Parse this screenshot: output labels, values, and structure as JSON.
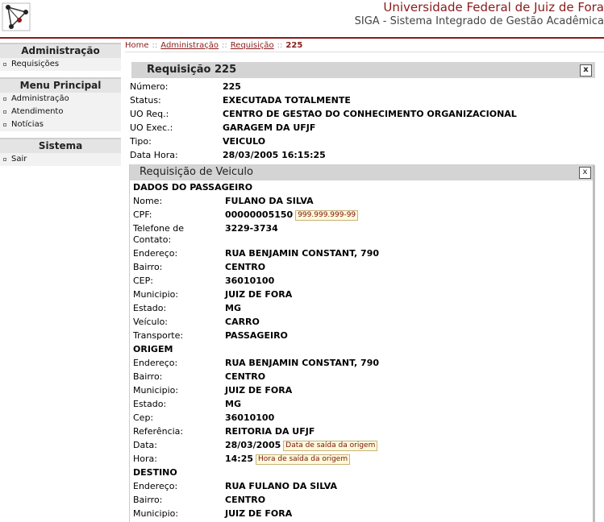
{
  "header": {
    "title": "Universidade Federal de Juiz de Fora",
    "subtitle": "SIGA - Sistema Integrado de Gestão Acadêmica",
    "accent": "#8b1a1a"
  },
  "sidebar": {
    "sections": [
      {
        "title": "Administração",
        "items": [
          {
            "label": "Requisições"
          }
        ]
      },
      {
        "title": "Menu Principal",
        "items": [
          {
            "label": "Administração"
          },
          {
            "label": "Atendimento"
          },
          {
            "label": "Notícias"
          }
        ]
      },
      {
        "title": "Sistema",
        "items": [
          {
            "label": "Sair"
          }
        ]
      }
    ]
  },
  "breadcrumb": {
    "home": "Home",
    "sep": "::",
    "admin": "Administração",
    "req": "Requisição",
    "current": "225"
  },
  "requisicao": {
    "title": "Requisição 225",
    "close": "x",
    "fields": [
      {
        "label": "Número:",
        "value": "225"
      },
      {
        "label": "Status:",
        "value": "EXECUTADA TOTALMENTE"
      },
      {
        "label": "UO Req.:",
        "value": "CENTRO DE GESTAO DO CONHECIMENTO ORGANIZACIONAL"
      },
      {
        "label": "UO Exec.:",
        "value": "GARAGEM DA UFJF"
      },
      {
        "label": "Tipo:",
        "value": "VEICULO"
      },
      {
        "label": "Data Hora:",
        "value": "28/03/2005 16:15:25"
      }
    ]
  },
  "veiculo": {
    "title": "Requisição de Veiculo",
    "close": "x",
    "passageiro": {
      "heading": "DADOS DO PASSAGEIRO",
      "nome_label": "Nome:",
      "nome": "FULANO DA SILVA",
      "cpf_label": "CPF:",
      "cpf": "00000005150",
      "cpf_hint": "999.999.999-99",
      "tel_label": "Telefone de Contato:",
      "tel": "3229-3734",
      "end_label": "Endereço:",
      "end": "RUA BENJAMIN CONSTANT, 790",
      "bairro_label": "Bairro:",
      "bairro": "CENTRO",
      "cep_label": "CEP:",
      "cep": "36010100",
      "mun_label": "Municipio:",
      "mun": "JUIZ DE FORA",
      "estado_label": "Estado:",
      "estado": "MG",
      "veic_label": "Veículo:",
      "veic": "CARRO",
      "transp_label": "Transporte:",
      "transp": "PASSAGEIRO"
    },
    "origem": {
      "heading": "ORIGEM",
      "end_label": "Endereço:",
      "end": "RUA BENJAMIN CONSTANT, 790",
      "bairro_label": "Bairro:",
      "bairro": "CENTRO",
      "mun_label": "Municipio:",
      "mun": "JUIZ DE FORA",
      "estado_label": "Estado:",
      "estado": "MG",
      "cep_label": "Cep:",
      "cep": "36010100",
      "ref_label": "Referência:",
      "ref": "REITORIA DA UFJF",
      "data_label": "Data:",
      "data": "28/03/2005",
      "data_hint": "Data de saída da origem",
      "hora_label": "Hora:",
      "hora": "14:25",
      "hora_hint": "Hora de saída da origem"
    },
    "destino": {
      "heading": "DESTINO",
      "end_label": "Endereço:",
      "end": "RUA FULANO DA SILVA",
      "bairro_label": "Bairro:",
      "bairro": "CENTRO",
      "mun_label": "Municipio:",
      "mun": "JUIZ DE FORA"
    }
  }
}
